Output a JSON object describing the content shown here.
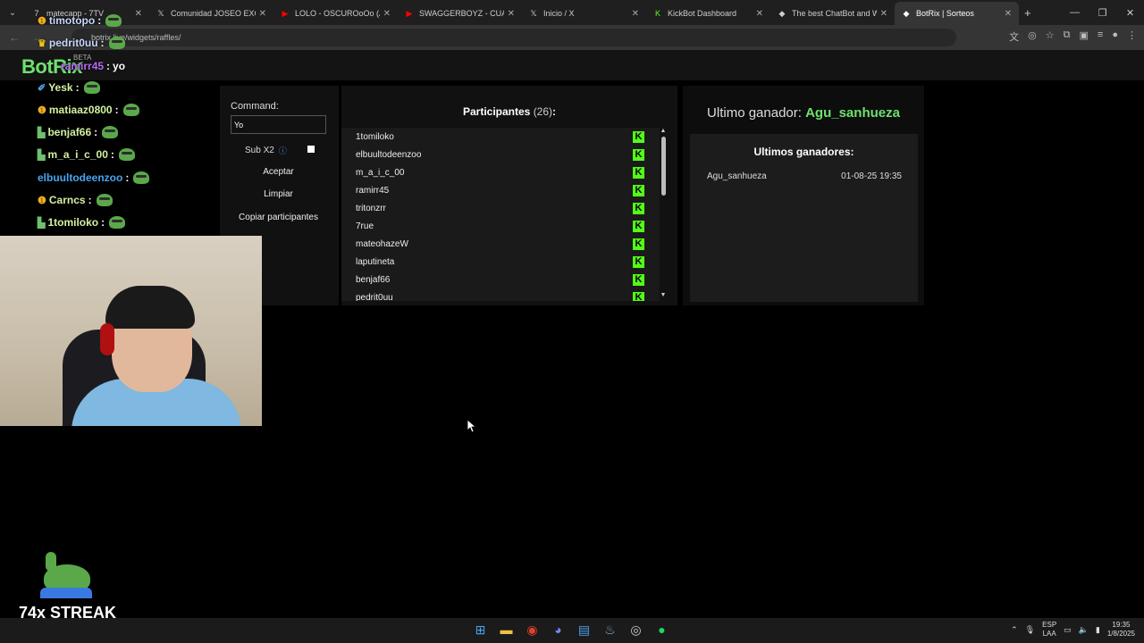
{
  "browser": {
    "tabs": [
      {
        "title": "matecapp - 7TV",
        "icon": "7tv-icon",
        "active": false
      },
      {
        "title": "Comunidad JOSEO EXCLU",
        "icon": "x-icon",
        "active": false
      },
      {
        "title": "LOLO - OSCUROoOo (Au",
        "icon": "youtube-icon",
        "active": false
      },
      {
        "title": "SWAGGERBOYZ - CUAND",
        "icon": "youtube-icon",
        "active": false
      },
      {
        "title": "Inicio / X",
        "icon": "x-icon",
        "active": false
      },
      {
        "title": "KickBot Dashboard",
        "icon": "kick-icon",
        "active": false
      },
      {
        "title": "The best ChatBot and Wi",
        "icon": "botrix-icon",
        "active": false
      },
      {
        "title": "BotRix | Sorteos",
        "icon": "botrix-icon",
        "active": true
      }
    ],
    "url": "botrix.live/widgets/raffles/"
  },
  "site": {
    "logo": "BotRix",
    "beta": "BETA"
  },
  "raffle": {
    "command_label": "Command:",
    "command_value": "Yo",
    "sub_label": "Sub X2",
    "accept_label": "Aceptar",
    "clear_label": "Limpiar",
    "copy_label": "Copiar participantes",
    "participants_title": "Participantes",
    "participants_count": "(26)",
    "participants_colon": ":",
    "participants": [
      "1tomiloko",
      "elbuultodeenzoo",
      "m_a_i_c_00",
      "ramirr45",
      "tritonzrr",
      "7rue",
      "mateohazeW",
      "laputineta",
      "benjaf66",
      "pedrit0uu"
    ]
  },
  "winner": {
    "label": "Ultimo ganador:",
    "name": "Agu_sanhueza",
    "history_title": "Ultimos ganadores:",
    "history": [
      {
        "name": "Agu_sanhueza",
        "date": "01-08-25 19:35"
      }
    ]
  },
  "chat": {
    "messages": [
      {
        "user": "timotopo",
        "color": "#c9d8ff",
        "text": ""
      },
      {
        "user": "pedrit0uu",
        "color": "#c9d8ff",
        "text": ""
      },
      {
        "user": "ramirr45",
        "color": "#b46cf0",
        "text": "yo"
      },
      {
        "user": "Yesk",
        "color": "#d3f0a0",
        "text": ""
      },
      {
        "user": "matiaaz0800",
        "color": "#d3f0a0",
        "text": ""
      },
      {
        "user": "benjaf66",
        "color": "#d3f0a0",
        "text": ""
      },
      {
        "user": "m_a_i_c_00",
        "color": "#d3f0a0",
        "text": ""
      },
      {
        "user": "elbuultodeenzoo",
        "color": "#4aa3f0",
        "text": ""
      },
      {
        "user": "Carncs",
        "color": "#d3f0a0",
        "text": ""
      },
      {
        "user": "1tomiloko",
        "color": "#d3f0a0",
        "text": ""
      }
    ]
  },
  "overlay": {
    "streak": "74x STREAK"
  },
  "taskbar": {
    "lang_top": "ESP",
    "lang_bottom": "LAA",
    "time": "19:35",
    "date": "1/8/2025"
  },
  "colors": {
    "kick_green": "#53fc18",
    "winner_green": "#6ee06e"
  }
}
